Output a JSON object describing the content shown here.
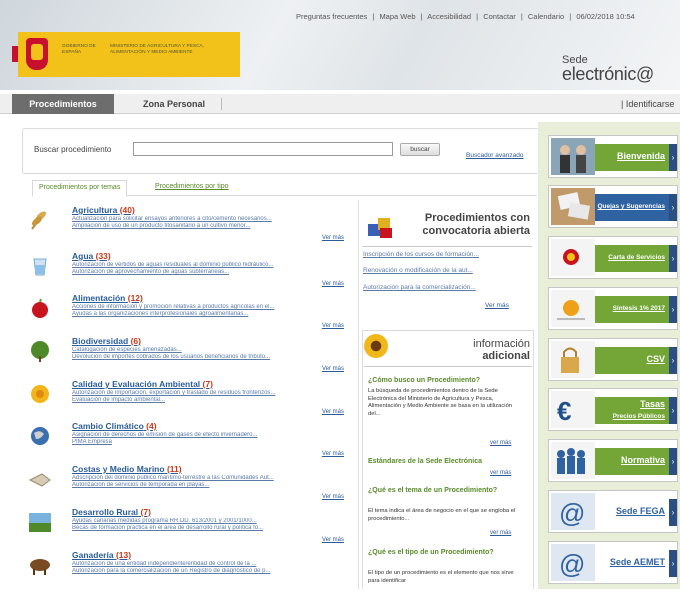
{
  "header": {
    "top_links": [
      "Preguntas frecuentes",
      "|",
      "Mapa Web",
      "|",
      "Accesibilidad",
      "|",
      "Contactar",
      "|",
      "Calendario",
      "|",
      "06/02/2018 10:54"
    ],
    "logo_text_1": "GOBIERNO DE ESPAÑA",
    "logo_text_2": "MINISTERIO DE AGRICULTURA Y PESCA, ALIMENTACIÓN Y MEDIO AMBIENTE",
    "sede_line1": "Sede",
    "sede_line2": "electrónic@"
  },
  "nav": {
    "tab_procedimientos": "Procedimientos",
    "tab_zona_personal": "Zona Personal",
    "identificarse": "| Identificarse"
  },
  "search": {
    "label": "Buscar procedimiento",
    "value": "",
    "button": "buscar",
    "advanced": "Buscador avanzado"
  },
  "subtabs": {
    "by_theme": "Procedimientos por temas",
    "by_type": "Procedimientos por tipo"
  },
  "categories": [
    {
      "name": "Agricultura",
      "count": "(40)",
      "l1": "Actualización para solicitar ensayos anteriores a cito/cemento necesarios...",
      "l2": "Ampliación de uso de un producto fitosanitario a un cultivo menor...",
      "more": "Ver más",
      "icon": "wheat-icon"
    },
    {
      "name": "Agua",
      "count": "(33)",
      "l1": "Autorización de vertidos de aguas residuales al dominio público hidráulico...",
      "l2": "Autorización de aprovechamiento de aguas subterráneas...",
      "more": "Ver más",
      "icon": "water-glass-icon"
    },
    {
      "name": "Alimentación",
      "count": "(12)",
      "l1": "Acciones de información y promoción relativas a productos agrícolas en el...",
      "l2": "Ayudas a las organizaciones interprofesionales agroalimentarias...",
      "more": "Ver más",
      "icon": "apple-icon"
    },
    {
      "name": "Biodiversidad",
      "count": "(6)",
      "l1": "Catalogación de especies amenazadas...",
      "l2": "Devolución de importes cobrados de los usuarios beneficiarios de tributo...",
      "more": "Ver más",
      "icon": "tree-icon"
    },
    {
      "name": "Calidad y Evaluación Ambiental",
      "count": "(7)",
      "l1": "Autorización de importación, exportación y traslado de residuos fronterizos...",
      "l2": "Evaluación de impacto ambiental...",
      "more": "Ver más",
      "icon": "flower-icon"
    },
    {
      "name": "Cambio Climático",
      "count": "(4)",
      "l1": "Asignación de derechos de emisión de gases de efecto invernadero...",
      "l2": "PIMA Empresa",
      "more": "Ver más",
      "icon": "globe-icon"
    },
    {
      "name": "Costas y Medio Marino",
      "count": "(11)",
      "l1": "Adscripción del dominio público marítimo-terrestre a las Comunidades Aut...",
      "l2": "Autorización de servicios de temporada en playas...",
      "more": "Ver más",
      "icon": "shell-icon"
    },
    {
      "name": "Desarrollo Rural",
      "count": "(7)",
      "l1": "Ayudas canarias medidas programa RR.DD. 613/2001 y 2001/1000...",
      "l2": "Becas de formación práctica en el área de desarrollo rural y política fo...",
      "more": "Ver más",
      "icon": "landscape-icon"
    },
    {
      "name": "Ganadería",
      "count": "(13)",
      "l1": "Autorización de una entidad independiente/entidad de control de la ...",
      "l2": "Autorización para la comercialización de un Registro de diagnóstico de p...",
      "more": "Ver más",
      "icon": "cow-icon"
    }
  ],
  "convocatoria": {
    "title": "Procedimientos con convocatoria abierta",
    "links": [
      "Inscripción de los cursos de formación...",
      "Renovación o modificación de la aut...",
      "Autorización para la comercialización..."
    ],
    "more": "Ver más"
  },
  "info": {
    "title_1": "información",
    "title_2": "adicional",
    "q1": "¿Cómo busco un Procedimiento?",
    "a1": "La búsqueda de procedimientos dentro de la Sede Electrónica del Ministerio de Agricultura y Pesca, Alimentación y Medio Ambiente se basa en la utilización del...",
    "more1": "ver más",
    "q2": "Estándares de la Sede Electrónica",
    "more2": "ver más",
    "q3": "¿Qué es el tema de un Procedimiento?",
    "a3": "El tema indica el área de negocio en el que se engloba el procedimiento...",
    "more3": "ver más",
    "q4": "¿Qué es el tipo de un Procedimiento?",
    "a4": "El tipo de un procedimiento es el elemento que nos sirve para identificar"
  },
  "right_buttons": [
    {
      "label": "Bienvenida",
      "style": "green",
      "icon": "people-photo-icon"
    },
    {
      "label": "Quejas y Sugerencias",
      "style": "blue",
      "icon": "hands-papers-icon"
    },
    {
      "label": "Carta de Servicios",
      "style": "green",
      "icon": "seal-icon"
    },
    {
      "label": "Síntesis 1% 2017",
      "style": "green",
      "icon": "orange-circle-icon"
    },
    {
      "label": "CSV",
      "style": "green",
      "icon": "padlock-icon"
    },
    {
      "label": "Tasas",
      "sub": "Precios Públicos",
      "style": "green",
      "icon": "euro-icon"
    },
    {
      "label": "Normativa",
      "style": "green",
      "icon": "crowd-icon"
    },
    {
      "label": "Sede FEGA",
      "style": "plain",
      "icon": "at-icon"
    },
    {
      "label": "Sede AEMET",
      "style": "plain",
      "icon": "at-icon"
    }
  ],
  "colors": {
    "green_accent": "#73a636",
    "blue_accent": "#2f62a0",
    "link": "#2a5c9a",
    "count_red": "#c83a1a"
  }
}
